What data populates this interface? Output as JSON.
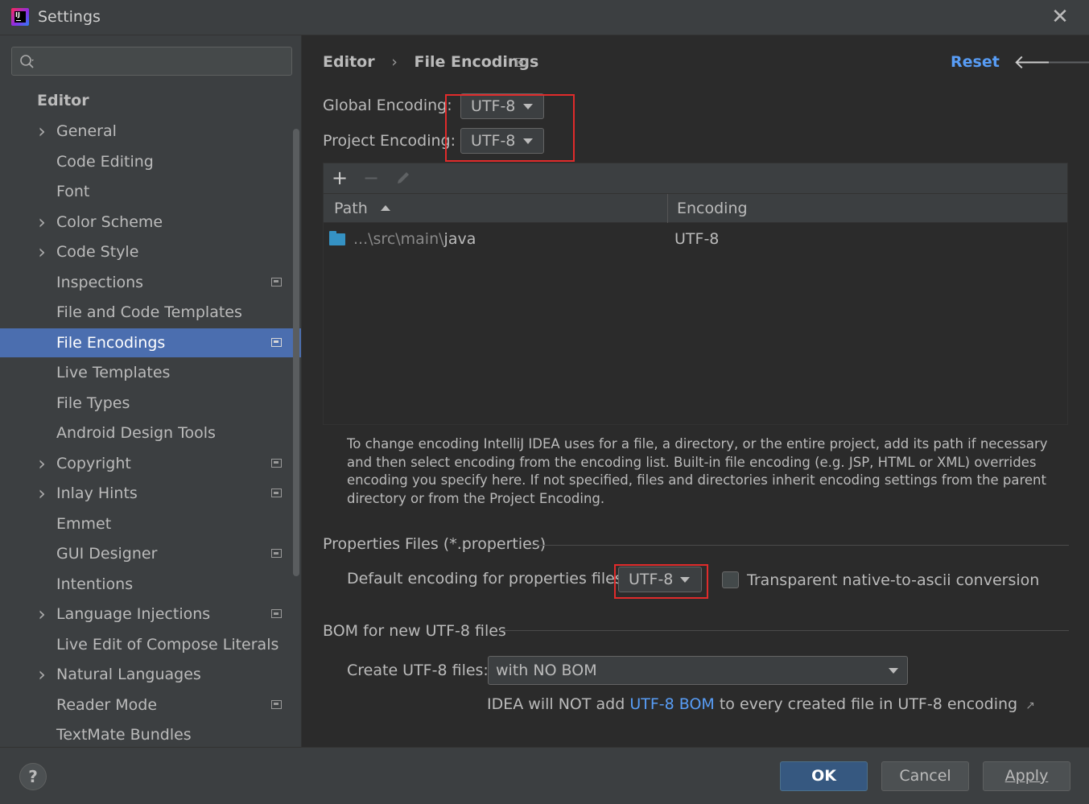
{
  "window": {
    "title": "Settings"
  },
  "sidebar": {
    "search_placeholder": "",
    "group_header": "Editor",
    "items": [
      {
        "label": "General",
        "expandable": true,
        "project_icon": false
      },
      {
        "label": "Code Editing",
        "expandable": false,
        "project_icon": false
      },
      {
        "label": "Font",
        "expandable": false,
        "project_icon": false
      },
      {
        "label": "Color Scheme",
        "expandable": true,
        "project_icon": false
      },
      {
        "label": "Code Style",
        "expandable": true,
        "project_icon": false
      },
      {
        "label": "Inspections",
        "expandable": false,
        "project_icon": true
      },
      {
        "label": "File and Code Templates",
        "expandable": false,
        "project_icon": false
      },
      {
        "label": "File Encodings",
        "expandable": false,
        "project_icon": true,
        "selected": true
      },
      {
        "label": "Live Templates",
        "expandable": false,
        "project_icon": false
      },
      {
        "label": "File Types",
        "expandable": false,
        "project_icon": false
      },
      {
        "label": "Android Design Tools",
        "expandable": false,
        "project_icon": false
      },
      {
        "label": "Copyright",
        "expandable": true,
        "project_icon": true
      },
      {
        "label": "Inlay Hints",
        "expandable": true,
        "project_icon": true
      },
      {
        "label": "Emmet",
        "expandable": false,
        "project_icon": false
      },
      {
        "label": "GUI Designer",
        "expandable": false,
        "project_icon": true
      },
      {
        "label": "Intentions",
        "expandable": false,
        "project_icon": false
      },
      {
        "label": "Language Injections",
        "expandable": true,
        "project_icon": true
      },
      {
        "label": "Live Edit of Compose Literals",
        "expandable": false,
        "project_icon": false
      },
      {
        "label": "Natural Languages",
        "expandable": true,
        "project_icon": false
      },
      {
        "label": "Reader Mode",
        "expandable": false,
        "project_icon": true
      },
      {
        "label": "TextMate Bundles",
        "expandable": false,
        "project_icon": false
      }
    ]
  },
  "header": {
    "breadcrumb_parent": "Editor",
    "breadcrumb_separator": "›",
    "breadcrumb_current": "File Encodings",
    "reset_label": "Reset",
    "back_icon": "arrow-left-icon",
    "forward_icon": "arrow-right-icon"
  },
  "encodings": {
    "global_label": "Global Encoding:",
    "global_value": "UTF-8",
    "project_label": "Project Encoding:",
    "project_value": "UTF-8"
  },
  "table": {
    "toolbar": [
      "add-icon",
      "remove-icon",
      "edit-icon"
    ],
    "columns": [
      "Path",
      "Encoding"
    ],
    "rows": [
      {
        "path_prefix": "...\\src\\main\\",
        "path_name": "java",
        "encoding": "UTF-8"
      }
    ]
  },
  "help_text": "To change encoding IntelliJ IDEA uses for a file, a directory, or the entire project, add its path if necessary and then select encoding from the encoding list. Built-in file encoding (e.g. JSP, HTML or XML) overrides encoding you specify here. If not specified, files and directories inherit encoding settings from the parent directory or from the Project Encoding.",
  "properties": {
    "section_title": "Properties Files (*.properties)",
    "default_label": "Default encoding for properties files:",
    "default_value": "UTF-8",
    "transparent_label": "Transparent native-to-ascii conversion",
    "transparent_checked": false
  },
  "bom": {
    "section_title": "BOM for new UTF-8 files",
    "create_label": "Create UTF-8 files:",
    "create_value": "with NO BOM",
    "note_prefix": "IDEA will NOT add ",
    "note_link": "UTF-8 BOM",
    "note_suffix": " to every created file in UTF-8 encoding",
    "note_icon": "external-link-icon"
  },
  "footer": {
    "help_label": "?",
    "ok_label": "OK",
    "cancel_label": "Cancel",
    "apply_label": "Apply"
  },
  "colors": {
    "accent": "#4b6eaf",
    "link": "#589df6",
    "highlight_box": "#e02b2b",
    "ok_button": "#365880"
  }
}
